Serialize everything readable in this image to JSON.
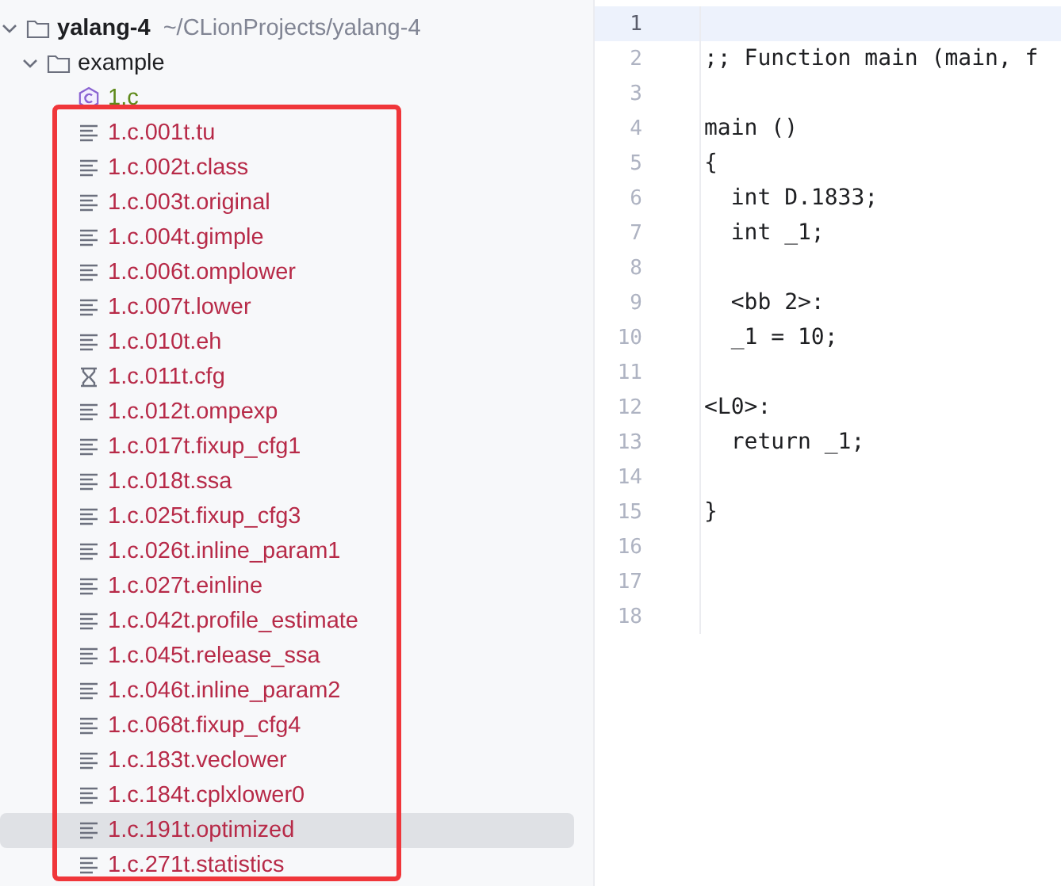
{
  "project_tree": {
    "name": "yalang-4",
    "path": "~/CLionProjects/yalang-4",
    "expanded": true,
    "children": [
      {
        "name": "example",
        "expanded": true,
        "children": [
          {
            "name": "1.c",
            "kind": "c-source",
            "color": "#5f8a1a",
            "selected": false
          },
          {
            "name": "1.c.001t.tu",
            "kind": "text",
            "color": "#b72a48",
            "selected": false
          },
          {
            "name": "1.c.002t.class",
            "kind": "text",
            "color": "#b72a48",
            "selected": false
          },
          {
            "name": "1.c.003t.original",
            "kind": "text",
            "color": "#b72a48",
            "selected": false
          },
          {
            "name": "1.c.004t.gimple",
            "kind": "text",
            "color": "#b72a48",
            "selected": false
          },
          {
            "name": "1.c.006t.omplower",
            "kind": "text",
            "color": "#b72a48",
            "selected": false
          },
          {
            "name": "1.c.007t.lower",
            "kind": "text",
            "color": "#b72a48",
            "selected": false
          },
          {
            "name": "1.c.010t.eh",
            "kind": "text",
            "color": "#b72a48",
            "selected": false
          },
          {
            "name": "1.c.011t.cfg",
            "kind": "cfg",
            "color": "#b72a48",
            "selected": false
          },
          {
            "name": "1.c.012t.ompexp",
            "kind": "text",
            "color": "#b72a48",
            "selected": false
          },
          {
            "name": "1.c.017t.fixup_cfg1",
            "kind": "text",
            "color": "#b72a48",
            "selected": false
          },
          {
            "name": "1.c.018t.ssa",
            "kind": "text",
            "color": "#b72a48",
            "selected": false
          },
          {
            "name": "1.c.025t.fixup_cfg3",
            "kind": "text",
            "color": "#b72a48",
            "selected": false
          },
          {
            "name": "1.c.026t.inline_param1",
            "kind": "text",
            "color": "#b72a48",
            "selected": false
          },
          {
            "name": "1.c.027t.einline",
            "kind": "text",
            "color": "#b72a48",
            "selected": false
          },
          {
            "name": "1.c.042t.profile_estimate",
            "kind": "text",
            "color": "#b72a48",
            "selected": false
          },
          {
            "name": "1.c.045t.release_ssa",
            "kind": "text",
            "color": "#b72a48",
            "selected": false
          },
          {
            "name": "1.c.046t.inline_param2",
            "kind": "text",
            "color": "#b72a48",
            "selected": false
          },
          {
            "name": "1.c.068t.fixup_cfg4",
            "kind": "text",
            "color": "#b72a48",
            "selected": false
          },
          {
            "name": "1.c.183t.veclower",
            "kind": "text",
            "color": "#b72a48",
            "selected": false
          },
          {
            "name": "1.c.184t.cplxlower0",
            "kind": "text",
            "color": "#b72a48",
            "selected": false
          },
          {
            "name": "1.c.191t.optimized",
            "kind": "text",
            "color": "#b72a48",
            "selected": true
          },
          {
            "name": "1.c.271t.statistics",
            "kind": "text",
            "color": "#b72a48",
            "selected": false
          }
        ]
      }
    ]
  },
  "editor": {
    "lines": [
      {
        "number": "1",
        "current": true
      },
      {
        "number": "2",
        "code": ";; Function main (main, f",
        "current": false
      },
      {
        "number": "3",
        "current": false
      },
      {
        "number": "4",
        "code": "main ()",
        "current": false
      },
      {
        "number": "5",
        "code": "{",
        "current": false
      },
      {
        "number": "6",
        "code": "  int D.1833;",
        "current": false
      },
      {
        "number": "7",
        "code": "  int _1;",
        "current": false
      },
      {
        "number": "8",
        "current": false
      },
      {
        "number": "9",
        "code": "  <bb 2>:",
        "current": false
      },
      {
        "number": "10",
        "code": "  _1 = 10;",
        "current": false
      },
      {
        "number": "11",
        "current": false
      },
      {
        "number": "12",
        "code": "<L0>:",
        "current": false
      },
      {
        "number": "13",
        "code": "  return _1;",
        "current": false
      },
      {
        "number": "14",
        "current": false
      },
      {
        "number": "15",
        "code": "}",
        "current": false
      },
      {
        "number": "16",
        "current": false
      },
      {
        "number": "17",
        "current": false
      },
      {
        "number": "18",
        "current": false
      }
    ]
  }
}
